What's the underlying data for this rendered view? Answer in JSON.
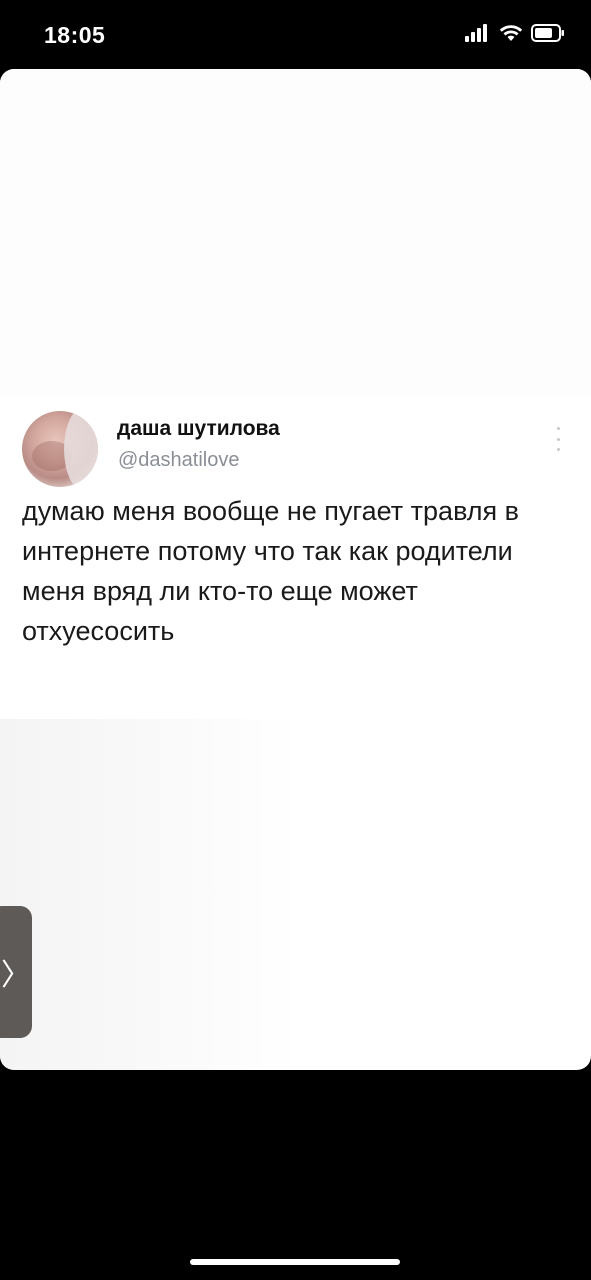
{
  "status_bar": {
    "time": "18:05",
    "icons": [
      "cellular-signal-icon",
      "wifi-icon",
      "battery-icon"
    ]
  },
  "tweet": {
    "display_name": "даша шутилова",
    "handle": "@dashatilove",
    "text": "думаю меня вообще не пугает травля в интернете потому что так как родители меня вряд ли кто-то еще может отхуесосить",
    "menu_icon": "more-vertical-icon"
  },
  "side_handle": {
    "icon": "chevron-right-icon",
    "glyph": "〉"
  },
  "colors": {
    "background": "#000000",
    "card": "#ffffff",
    "name_text": "#111111",
    "handle_text": "#8a8f96",
    "side_handle": "#5e5a57"
  }
}
